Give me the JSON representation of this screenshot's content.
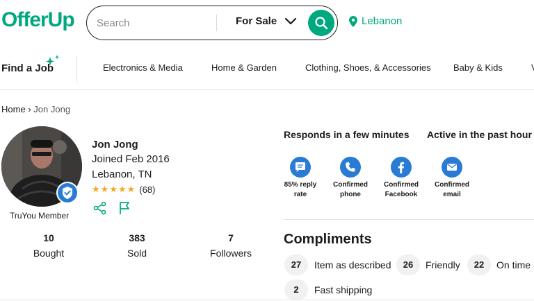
{
  "header": {
    "logo": "OfferUp",
    "search_placeholder": "Search",
    "sale_filter": "For Sale",
    "location": "Lebanon"
  },
  "categories": {
    "find_job": "Find a Job",
    "items": [
      "Electronics & Media",
      "Home & Garden",
      "Clothing, Shoes, & Accessories",
      "Baby & Kids",
      "V"
    ]
  },
  "breadcrumb": {
    "home": "Home",
    "separator": "›",
    "current": "Jon Jong"
  },
  "profile": {
    "name": "Jon Jong",
    "joined": "Joined Feb 2016",
    "location": "Lebanon, TN",
    "rating_stars": 5,
    "rating_count": "(68)",
    "truyou": "TruYou Member"
  },
  "stats": [
    {
      "value": "10",
      "label": "Bought"
    },
    {
      "value": "383",
      "label": "Sold"
    },
    {
      "value": "7",
      "label": "Followers"
    }
  ],
  "badges": {
    "responds": "Responds in a few minutes",
    "active": "Active in the past hour",
    "items": [
      {
        "line1": "85% reply",
        "line2": "rate",
        "icon": "chat-bubble-icon"
      },
      {
        "line1": "Confirmed",
        "line2": "phone",
        "icon": "phone-icon"
      },
      {
        "line1": "Confirmed",
        "line2": "Facebook",
        "icon": "facebook-icon"
      },
      {
        "line1": "Confirmed",
        "line2": "email",
        "icon": "email-icon"
      }
    ]
  },
  "compliments": {
    "title": "Compliments",
    "items": [
      {
        "count": "27",
        "label": "Item as described"
      },
      {
        "count": "26",
        "label": "Friendly"
      },
      {
        "count": "22",
        "label": "On time"
      },
      {
        "count": "2",
        "label": "Fast shipping"
      }
    ]
  },
  "colors": {
    "brand": "#00a87e",
    "badge_blue": "#2a7bd4",
    "star": "#f5a623"
  }
}
